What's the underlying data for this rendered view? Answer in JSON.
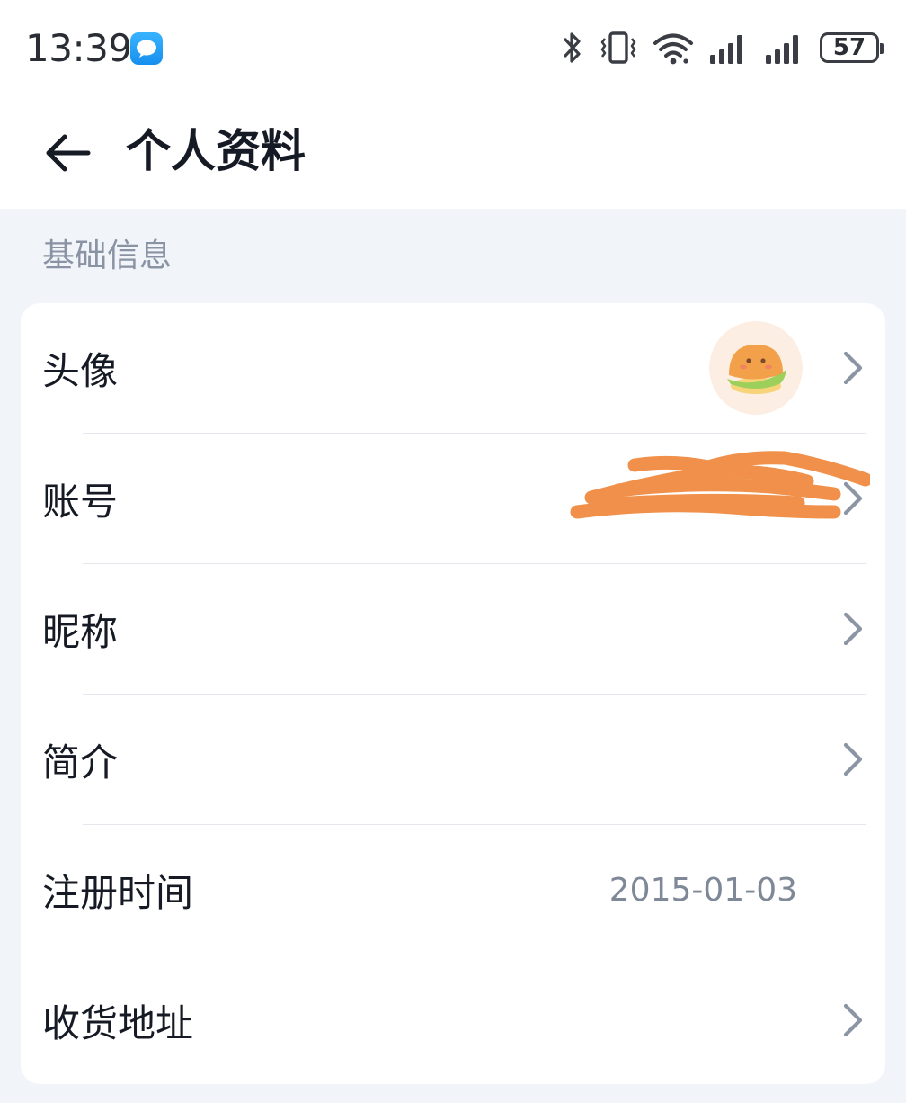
{
  "status_bar": {
    "time": "13:39",
    "battery": "57",
    "icons": [
      "message-app-icon",
      "bluetooth-icon",
      "vibrate-icon",
      "wifi-icon",
      "signal-1-icon",
      "signal-2-icon",
      "battery-icon"
    ]
  },
  "header": {
    "back_icon": "arrow-left-icon",
    "title": "个人资料"
  },
  "section": {
    "title": "基础信息"
  },
  "rows": [
    {
      "label": "头像",
      "value": "",
      "has_avatar": true,
      "has_chevron": true
    },
    {
      "label": "账号",
      "value": "",
      "redacted": true,
      "has_chevron": true
    },
    {
      "label": "昵称",
      "value": "",
      "has_chevron": true
    },
    {
      "label": "简介",
      "value": "",
      "has_chevron": true
    },
    {
      "label": "注册时间",
      "value": "2015-01-03",
      "has_chevron": false
    },
    {
      "label": "收货地址",
      "value": "",
      "has_chevron": true
    }
  ],
  "colors": {
    "page_bg": "#f1f4f8",
    "card_bg": "#ffffff",
    "text_primary": "#151a24",
    "text_secondary": "#8a93a3",
    "chevron": "#8c95a4",
    "redaction_scribble": "#f0904a"
  }
}
